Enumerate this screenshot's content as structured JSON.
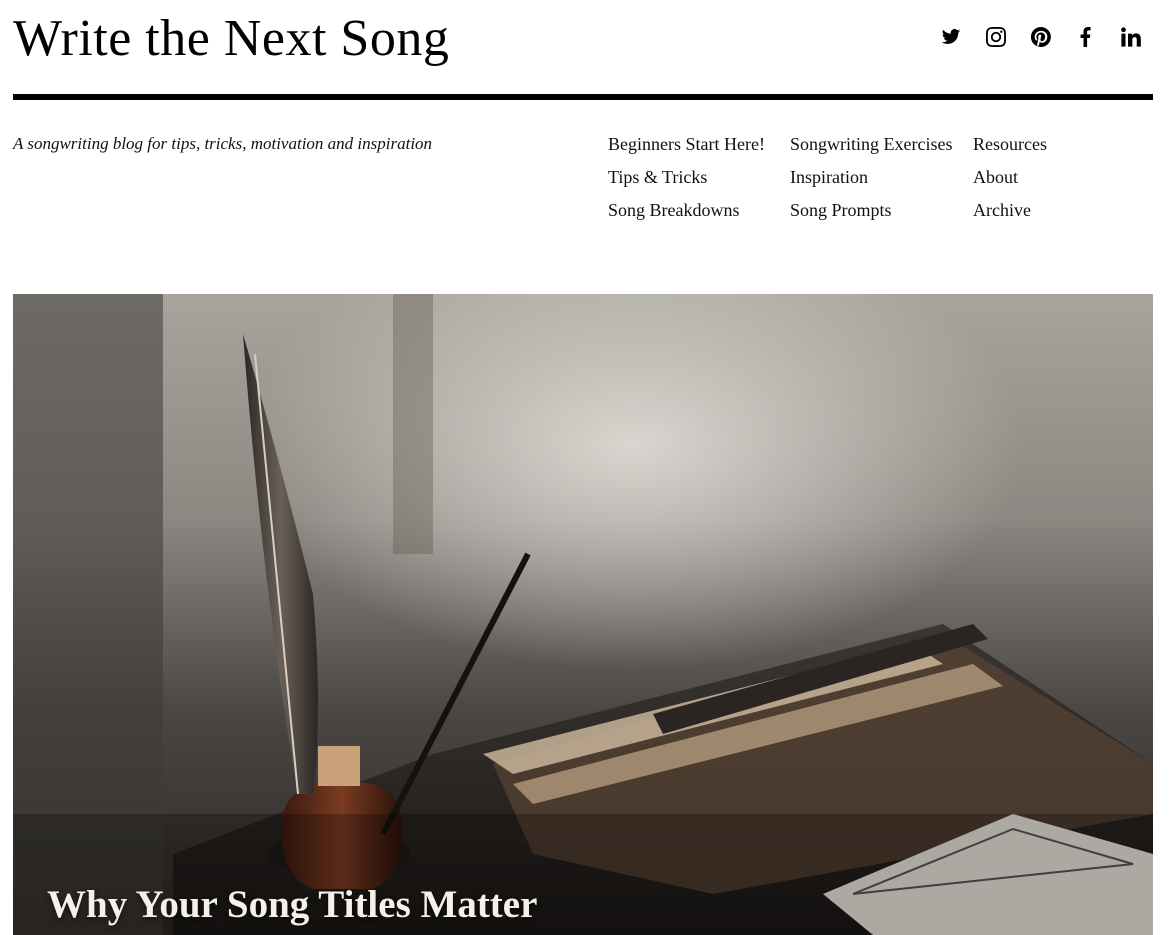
{
  "site": {
    "title": "Write the Next Song",
    "tagline": "A songwriting blog for tips, tricks, motivation and inspiration"
  },
  "social": [
    {
      "icon": "twitter-icon"
    },
    {
      "icon": "instagram-icon"
    },
    {
      "icon": "pinterest-icon"
    },
    {
      "icon": "facebook-icon"
    },
    {
      "icon": "linkedin-icon"
    }
  ],
  "nav": {
    "col1": [
      "Beginners Start Here!",
      "Tips & Tricks",
      "Song Breakdowns"
    ],
    "col2": [
      "Songwriting Exercises",
      "Inspiration",
      "Song Prompts"
    ],
    "col3": [
      "Resources",
      "About",
      "Archive"
    ]
  },
  "hero": {
    "title": "Why Your Song Titles Matter"
  },
  "colors": {
    "text": "#111111",
    "rule": "#000000",
    "hero_title": "#f4f1ea"
  }
}
